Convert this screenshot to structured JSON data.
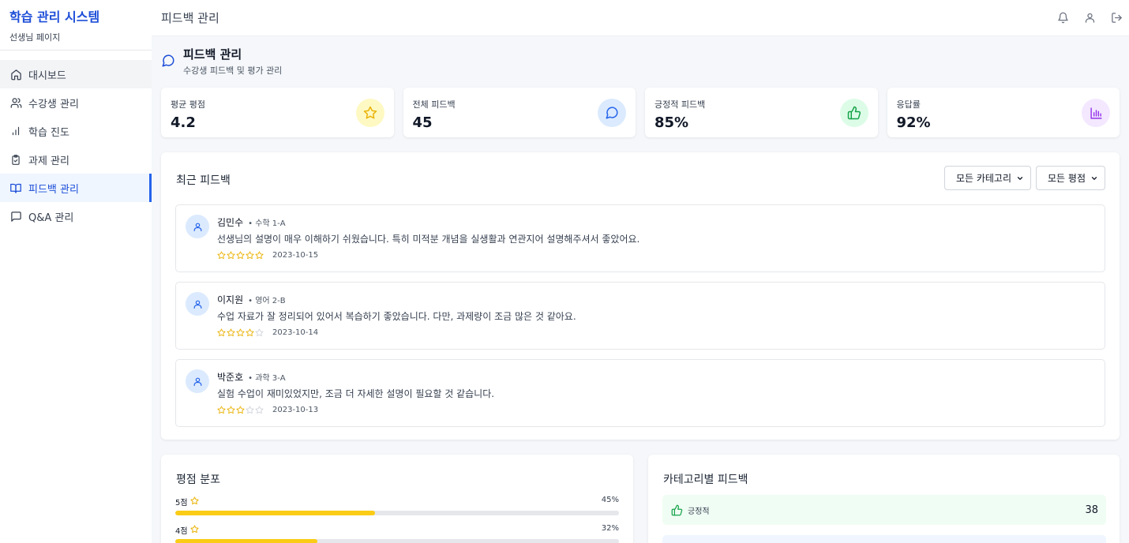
{
  "sidebar": {
    "title": "학습 관리 시스템",
    "subtitle": "선생님 페이지",
    "items": [
      {
        "label": "대시보드",
        "icon": "home-icon"
      },
      {
        "label": "수강생 관리",
        "icon": "users-icon"
      },
      {
        "label": "학습 진도",
        "icon": "bar-chart-icon"
      },
      {
        "label": "과제 관리",
        "icon": "clipboard-check-icon"
      },
      {
        "label": "피드백 관리",
        "icon": "book-open-icon"
      },
      {
        "label": "Q&A 관리",
        "icon": "message-square-icon"
      }
    ],
    "active_index": 4
  },
  "header": {
    "title": "피드백 관리",
    "icons": [
      "bell-icon",
      "user-icon",
      "logout-icon"
    ]
  },
  "page": {
    "title": "피드백 관리",
    "subtitle": "수강생 피드백 및 평가 관리"
  },
  "stats": [
    {
      "label": "평균 평점",
      "value": "4.2",
      "icon": "star-icon",
      "color": "#eab308",
      "bg": "#fef9c3"
    },
    {
      "label": "전체 피드백",
      "value": "45",
      "icon": "message-circle-icon",
      "color": "#2563eb",
      "bg": "#dbeafe"
    },
    {
      "label": "긍정적 피드백",
      "value": "85%",
      "icon": "thumbs-up-icon",
      "color": "#16a34a",
      "bg": "#dcfce7"
    },
    {
      "label": "응답률",
      "value": "92%",
      "icon": "bar-chart-icon",
      "color": "#9333ea",
      "bg": "#f3e8ff"
    }
  ],
  "recent": {
    "title": "최근 피드백",
    "category_filter": "모든 카테고리",
    "rating_filter": "모든 평점",
    "items": [
      {
        "name": "김민수",
        "course": "• 수학 1-A",
        "comment": "선생님의 설명이 매우 이해하기 쉬웠습니다. 특히 미적분 개념을 실생활과 연관지어 설명해주셔서 좋았어요.",
        "rating": 5,
        "date": "2023-10-15"
      },
      {
        "name": "이지원",
        "course": "• 영어 2-B",
        "comment": "수업 자료가 잘 정리되어 있어서 복습하기 좋았습니다. 다만, 과제량이 조금 많은 것 같아요.",
        "rating": 4,
        "date": "2023-10-14"
      },
      {
        "name": "박준호",
        "course": "• 과학 3-A",
        "comment": "실험 수업이 재미있었지만, 조금 더 자세한 설명이 필요할 것 같습니다.",
        "rating": 3,
        "date": "2023-10-13"
      }
    ]
  },
  "distribution": {
    "title": "평점 분포",
    "rows": [
      {
        "label": "5점",
        "pct_label": "45%",
        "pct": 45
      },
      {
        "label": "4점",
        "pct_label": "32%",
        "pct": 32
      }
    ]
  },
  "category": {
    "title": "카테고리별 피드백",
    "items": [
      {
        "label": "긍정적",
        "count": "38",
        "icon": "thumbs-up-icon",
        "bg": "#f0fdf4"
      }
    ]
  },
  "colors": {
    "accent": "#2563eb",
    "star": "#eab308",
    "star_empty": "#d1d5db"
  }
}
